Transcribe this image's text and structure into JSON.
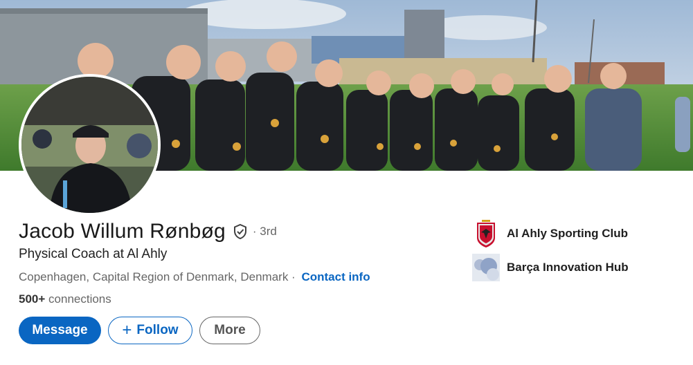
{
  "profile": {
    "name": "Jacob Willum Rønbøg",
    "degree": "· 3rd",
    "headline": "Physical Coach at Al Ahly",
    "location": "Copenhagen, Capital Region of Denmark, Denmark",
    "location_separator": " ·",
    "contact_info_label": "Contact info",
    "connections_count": "500+",
    "connections_label": "connections"
  },
  "actions": {
    "message_label": "Message",
    "follow_plus": "+",
    "follow_label": "Follow",
    "more_label": "More"
  },
  "organizations": [
    {
      "name": "Al Ahly Sporting Club",
      "icon": "al-ahly-logo"
    },
    {
      "name": "Barça Innovation Hub",
      "icon": "barca-innovation-hub-logo"
    }
  ],
  "colors": {
    "accent": "#0a66c2",
    "text_secondary": "#666666"
  }
}
